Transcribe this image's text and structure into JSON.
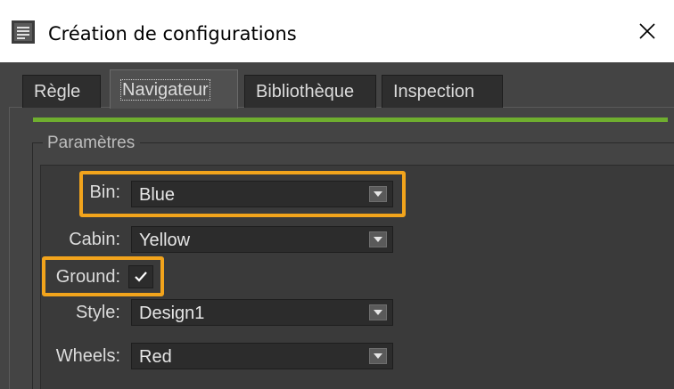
{
  "window": {
    "title": "Création de configurations",
    "app_icon": "document-list-icon",
    "close_icon": "close-icon"
  },
  "tabs": [
    {
      "label": "Règle",
      "active": false
    },
    {
      "label": "Navigateur",
      "active": true
    },
    {
      "label": "Bibliothèque",
      "active": false
    },
    {
      "label": "Inspection",
      "active": false
    }
  ],
  "group": {
    "legend": "Paramètres",
    "fields": [
      {
        "label": "Bin:",
        "value": "Blue"
      },
      {
        "label": "Cabin:",
        "value": "Yellow"
      },
      {
        "label": "Ground:",
        "checked": true
      },
      {
        "label": "Style:",
        "value": "Design1"
      },
      {
        "label": "Wheels:",
        "value": "Red"
      }
    ]
  },
  "colors": {
    "accent_bar": "#6fae2f",
    "highlight": "#f2a41c",
    "panel_bg": "#444444"
  }
}
